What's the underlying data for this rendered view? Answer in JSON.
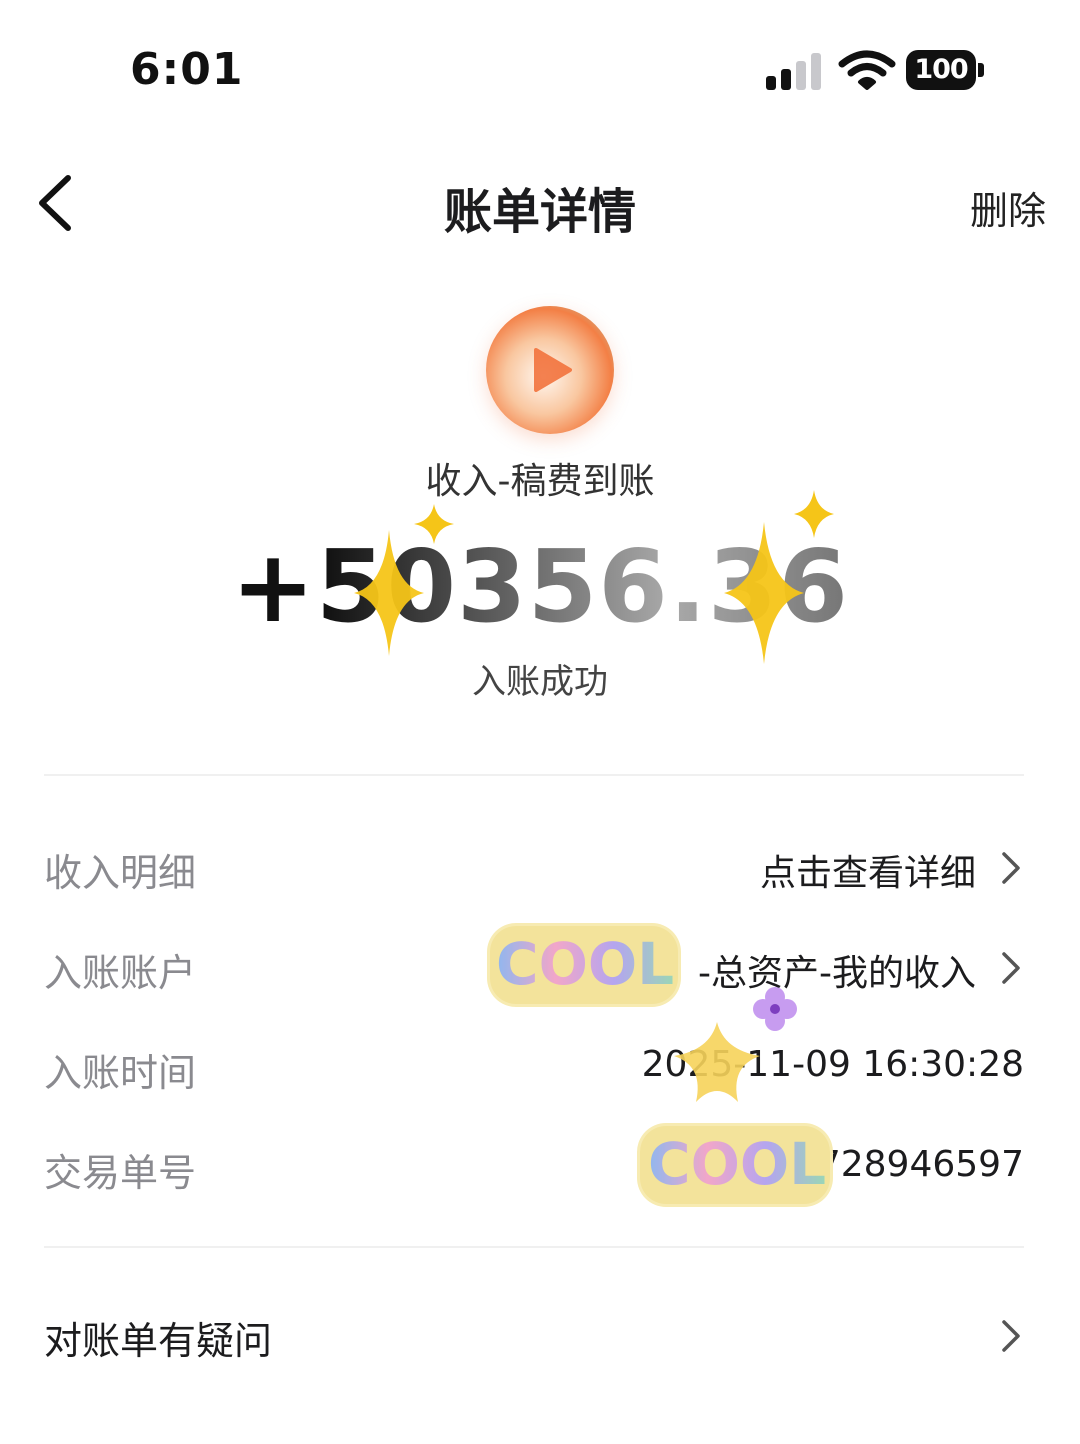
{
  "status_bar": {
    "time": "6:01",
    "battery": "100",
    "icons": [
      "signal-icon",
      "wifi-icon",
      "battery-icon"
    ]
  },
  "nav": {
    "back_icon": "chevron-left-icon",
    "title": "账单详情",
    "delete_label": "删除"
  },
  "transaction": {
    "logo_icon": "video-app-logo-icon",
    "type": "收入-稿费到账",
    "amount": "+50356.36",
    "status": "入账成功"
  },
  "details": [
    {
      "label": "收入明细",
      "value": "点击查看详细",
      "has_chevron": true
    },
    {
      "label": "入账账户",
      "value": "-总资产-我的收入",
      "has_chevron": true
    },
    {
      "label": "入账时间",
      "value": "2025-11-09   16:30:28",
      "has_chevron": false
    },
    {
      "label": "交易单号",
      "value": "TT365                728946597",
      "has_chevron": false
    }
  ],
  "stickers": {
    "cool_text": "COOL"
  },
  "query": {
    "label": "对账单有疑问"
  },
  "colors": {
    "label_gray": "#8a8a8f",
    "text_dark": "#1c1c1e",
    "divider": "#f0f0f0",
    "sparkle_yellow": "#f5c518",
    "sticker_bg": "#f3e39b"
  }
}
